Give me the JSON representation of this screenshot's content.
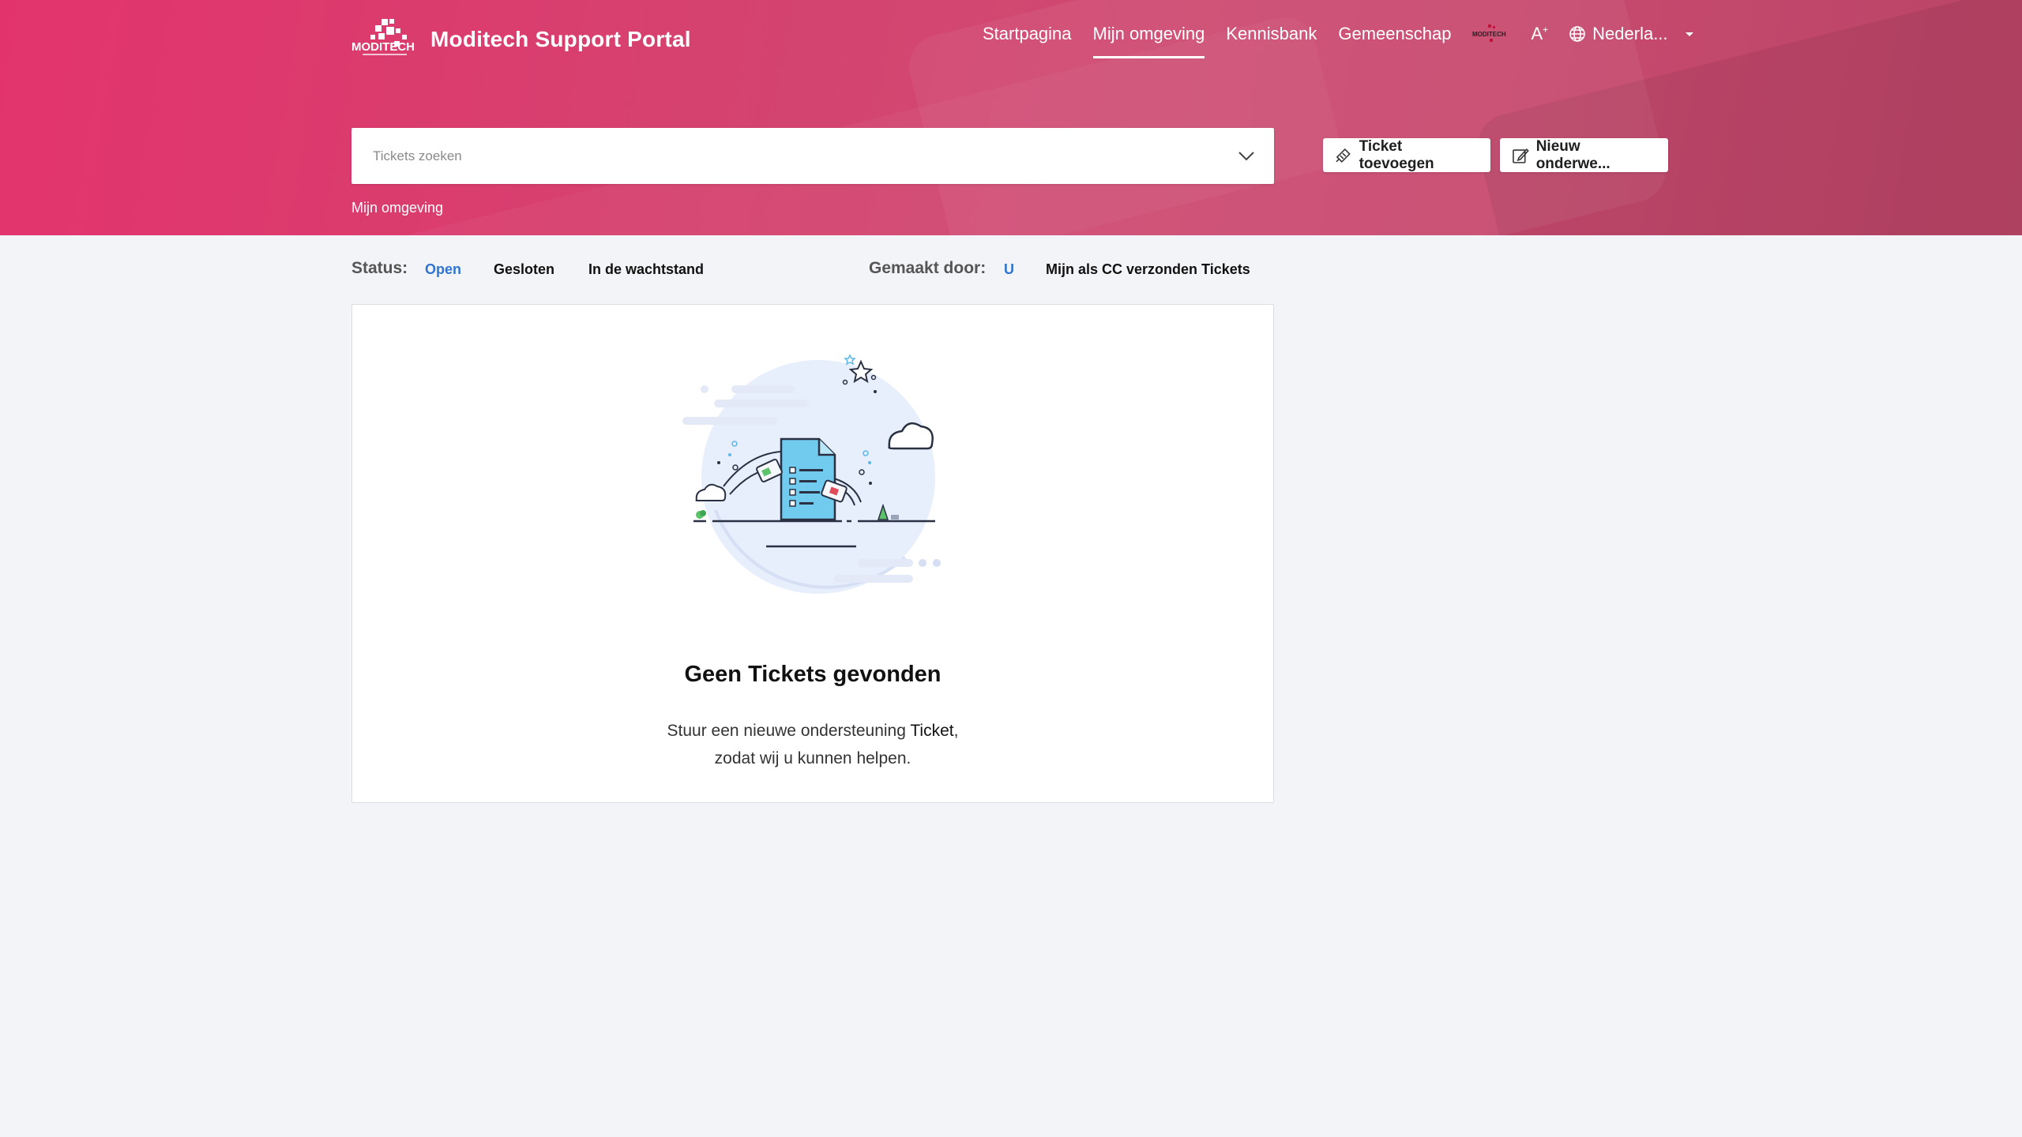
{
  "header": {
    "title": "Moditech Support Portal",
    "logo_icon": "moditech-logo",
    "nav": [
      "Startpagina",
      "Mijn omgeving",
      "Kennisbank",
      "Gemeenschap"
    ],
    "nav_active": "Mijn omgeving",
    "font_size_label": "A",
    "language": "Nederla..."
  },
  "search": {
    "placeholder": "Tickets zoeken"
  },
  "actions": {
    "add_ticket": "Ticket toevoegen",
    "new_topic": "Nieuw onderwe..."
  },
  "breadcrumb": "Mijn omgeving",
  "filters": {
    "status_label": "Status:",
    "status_options": [
      "Open",
      "Gesloten",
      "In de wachtstand"
    ],
    "status_selected": "Open",
    "created_label": "Gemaakt door:",
    "created_options": [
      "U",
      "Mijn als CC verzonden Tickets"
    ],
    "created_selected": "U"
  },
  "empty": {
    "title": "Geen Tickets gevonden",
    "text_line1_prefix": "Stuur een nieuwe ondersteuning ",
    "text_line1_strong": "Ticket",
    "text_line1_suffix": ",",
    "text_line2": "zodat wij u kunnen helpen."
  },
  "colors": {
    "hero": "#d7406f",
    "accent_blue": "#2f74d0",
    "background": "#f3f4f7"
  }
}
